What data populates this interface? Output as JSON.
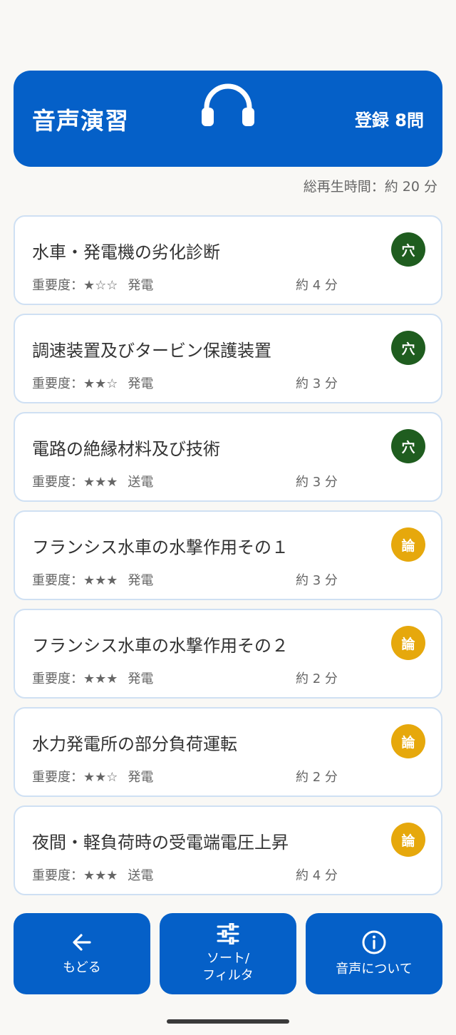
{
  "header": {
    "title": "音声演習",
    "count": "登録 8問",
    "icon": "headphones-icon"
  },
  "total_time": "総再生時間：約 20 分",
  "colors": {
    "primary": "#0560c8",
    "badge_ana": "#1f5d1f",
    "badge_ron": "#e6a80c",
    "card_border": "#cfe0f3"
  },
  "items": [
    {
      "title": "水車・発電機の劣化診断",
      "importance": "重要度：★☆☆",
      "category": "発電",
      "time": "約 4 分",
      "badge": "穴",
      "badge_type": "ana"
    },
    {
      "title": "調速装置及びタービン保護装置",
      "importance": "重要度：★★☆",
      "category": "発電",
      "time": "約 3 分",
      "badge": "穴",
      "badge_type": "ana"
    },
    {
      "title": "電路の絶縁材料及び技術",
      "importance": "重要度：★★★",
      "category": "送電",
      "time": "約 3 分",
      "badge": "穴",
      "badge_type": "ana"
    },
    {
      "title": "フランシス水車の水撃作用その１",
      "importance": "重要度：★★★",
      "category": "発電",
      "time": "約 3 分",
      "badge": "論",
      "badge_type": "ron"
    },
    {
      "title": "フランシス水車の水撃作用その２",
      "importance": "重要度：★★★",
      "category": "発電",
      "time": "約 2 分",
      "badge": "論",
      "badge_type": "ron"
    },
    {
      "title": "水力発電所の部分負荷運転",
      "importance": "重要度：★★☆",
      "category": "発電",
      "time": "約 2 分",
      "badge": "論",
      "badge_type": "ron"
    },
    {
      "title": "夜間・軽負荷時の受電端電圧上昇",
      "importance": "重要度：★★★",
      "category": "送電",
      "time": "約 4 分",
      "badge": "論",
      "badge_type": "ron"
    }
  ],
  "bottom": {
    "back_label": "もどる",
    "sort_label_1": "ソート/",
    "sort_label_2": "フィルタ",
    "about_label": "音声について"
  }
}
